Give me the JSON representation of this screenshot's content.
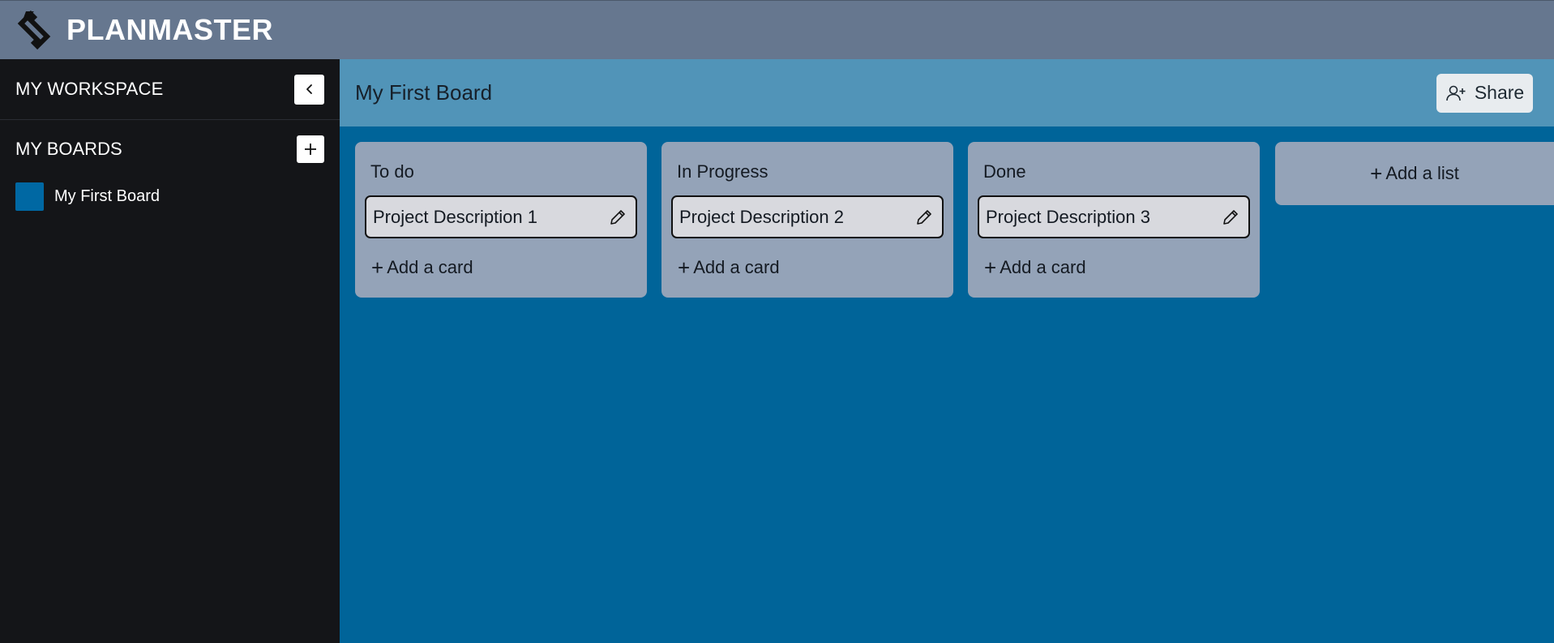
{
  "app": {
    "brand": "PLANMASTER"
  },
  "sidebar": {
    "workspace_title": "MY WORKSPACE",
    "boards_title": "MY BOARDS",
    "boards": [
      {
        "name": "My First Board",
        "color": "#0068a3"
      }
    ]
  },
  "board": {
    "title": "My First Board",
    "share_label": "Share",
    "lists": [
      {
        "title": "To do",
        "cards": [
          "Project Description 1"
        ],
        "add_card_label": "Add a card"
      },
      {
        "title": "In Progress",
        "cards": [
          "Project Description 2"
        ],
        "add_card_label": "Add a card"
      },
      {
        "title": "Done",
        "cards": [
          "Project Description 3"
        ],
        "add_card_label": "Add a card"
      }
    ],
    "add_list_label": "Add a list"
  },
  "colors": {
    "topbar": "#66778f",
    "sidebar": "#141518",
    "board_header": "#5194b8",
    "board_background": "#006499",
    "list_background": "#94a3b8",
    "card_background": "#d8d9de"
  }
}
